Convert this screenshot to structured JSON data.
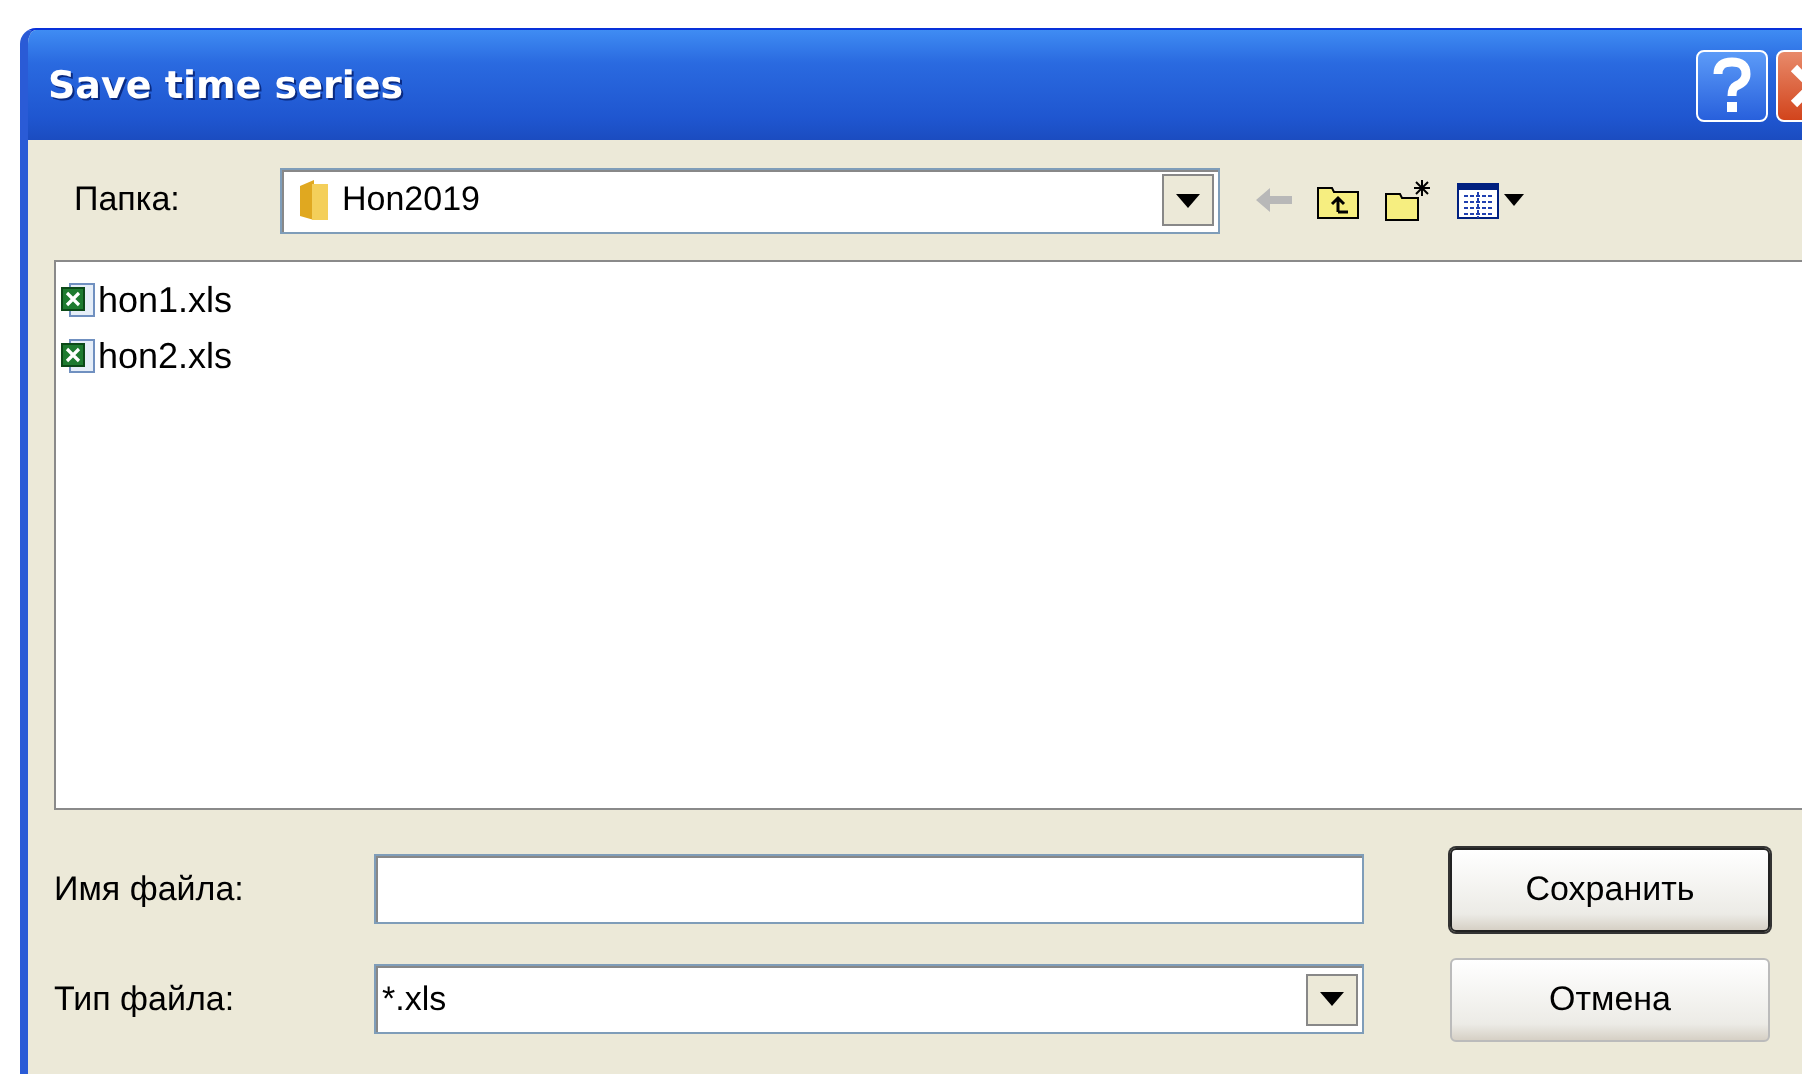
{
  "window": {
    "title": "Save time series"
  },
  "folder": {
    "label": "Папка:",
    "value": "Hon2019"
  },
  "files": [
    {
      "name": "hon1.xls"
    },
    {
      "name": "hon2.xls"
    }
  ],
  "file_name": {
    "label": "Имя файла:"
  },
  "file_type": {
    "label": "Тип файла:",
    "value": "*.xls"
  },
  "buttons": [
    {
      "label": "Сохранить",
      "default": true
    },
    {
      "label": "Отмена",
      "default": false
    }
  ]
}
